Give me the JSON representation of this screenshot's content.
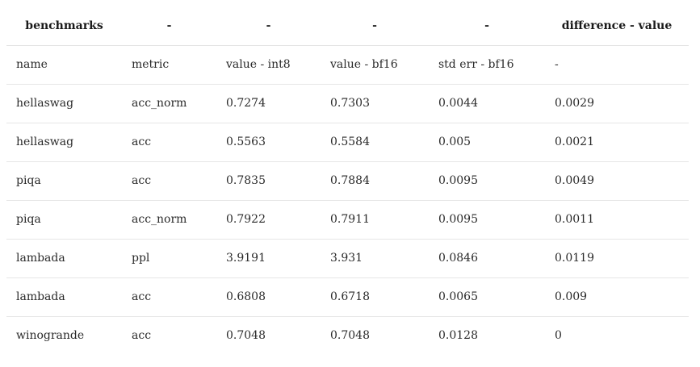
{
  "table": {
    "headers": [
      "benchmarks",
      "-",
      "-",
      "-",
      "-",
      "difference - value"
    ],
    "rows": [
      [
        "name",
        "metric",
        "value - int8",
        "value - bf16",
        "std err - bf16",
        "-"
      ],
      [
        "hellaswag",
        "acc_norm",
        "0.7274",
        "0.7303",
        "0.0044",
        "0.0029"
      ],
      [
        "hellaswag",
        "acc",
        "0.5563",
        "0.5584",
        "0.005",
        "0.0021"
      ],
      [
        "piqa",
        "acc",
        "0.7835",
        "0.7884",
        "0.0095",
        "0.0049"
      ],
      [
        "piqa",
        "acc_norm",
        "0.7922",
        "0.7911",
        "0.0095",
        "0.0011"
      ],
      [
        "lambada",
        "ppl",
        "3.9191",
        "3.931",
        "0.0846",
        "0.0119"
      ],
      [
        "lambada",
        "acc",
        "0.6808",
        "0.6718",
        "0.0065",
        "0.009"
      ],
      [
        "winogrande",
        "acc",
        "0.7048",
        "0.7048",
        "0.0128",
        "0"
      ]
    ]
  }
}
